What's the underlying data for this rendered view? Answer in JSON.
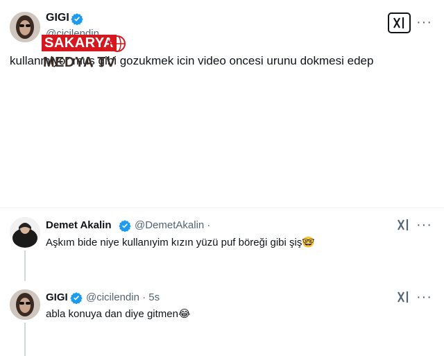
{
  "main_post": {
    "author_name": "GIGI",
    "author_handle": "@cicilendin",
    "text": "kullanmiyor muş gibi gozukmek icin video oncesi urunu dokmesi edep",
    "more_label": "···"
  },
  "watermark": {
    "line1": "SAKARYA",
    "line2": "MEDYA TV"
  },
  "reply1": {
    "author_name": "Demet Akalin",
    "author_handle": "@DemetAkalin ·",
    "text": "Aşkım bide niye kullanıyim kızın yüzü puf böreği gibi şiş🤓",
    "more_label": "···"
  },
  "reply2": {
    "author_name": "GIGI",
    "author_handle": "@cicilendin · 5s",
    "text": "abla konuya dan diye gitmen😂",
    "more_label": "···"
  },
  "colors": {
    "verified": "#1d9bf0",
    "watermark_red": "#d6171e",
    "secondary_text": "#536471"
  },
  "icons": {
    "grok": "grok-icon",
    "verified": "verified-badge-icon",
    "more": "more-options-icon"
  }
}
